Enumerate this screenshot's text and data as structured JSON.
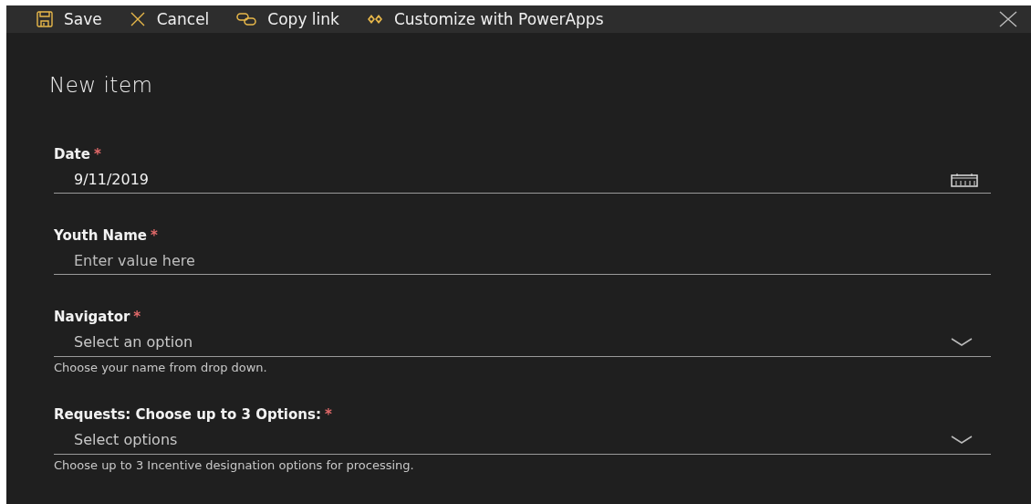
{
  "toolbar": {
    "actions": [
      {
        "kind": "save",
        "label": "Save"
      },
      {
        "kind": "cancel",
        "label": "Cancel"
      },
      {
        "kind": "link",
        "label": "Copy link"
      },
      {
        "kind": "powerapps",
        "label": "Customize with PowerApps"
      }
    ]
  },
  "form": {
    "title": "New item",
    "fields": [
      {
        "kind": "date",
        "label": "Date",
        "required_mark": "*",
        "value": "9/11/2019"
      },
      {
        "kind": "text",
        "label": "Youth Name",
        "required_mark": "*",
        "placeholder": "Enter value here"
      },
      {
        "kind": "dropdown",
        "label": "Navigator",
        "required_mark": "*",
        "placeholder": "Select an option",
        "help": "Choose your name from drop down."
      },
      {
        "kind": "dropdown",
        "label": "Requests: Choose up to 3 Options:",
        "required_mark": "*",
        "placeholder": "Select options",
        "help": "Choose up to 3 Incentive designation options for processing."
      }
    ]
  }
}
